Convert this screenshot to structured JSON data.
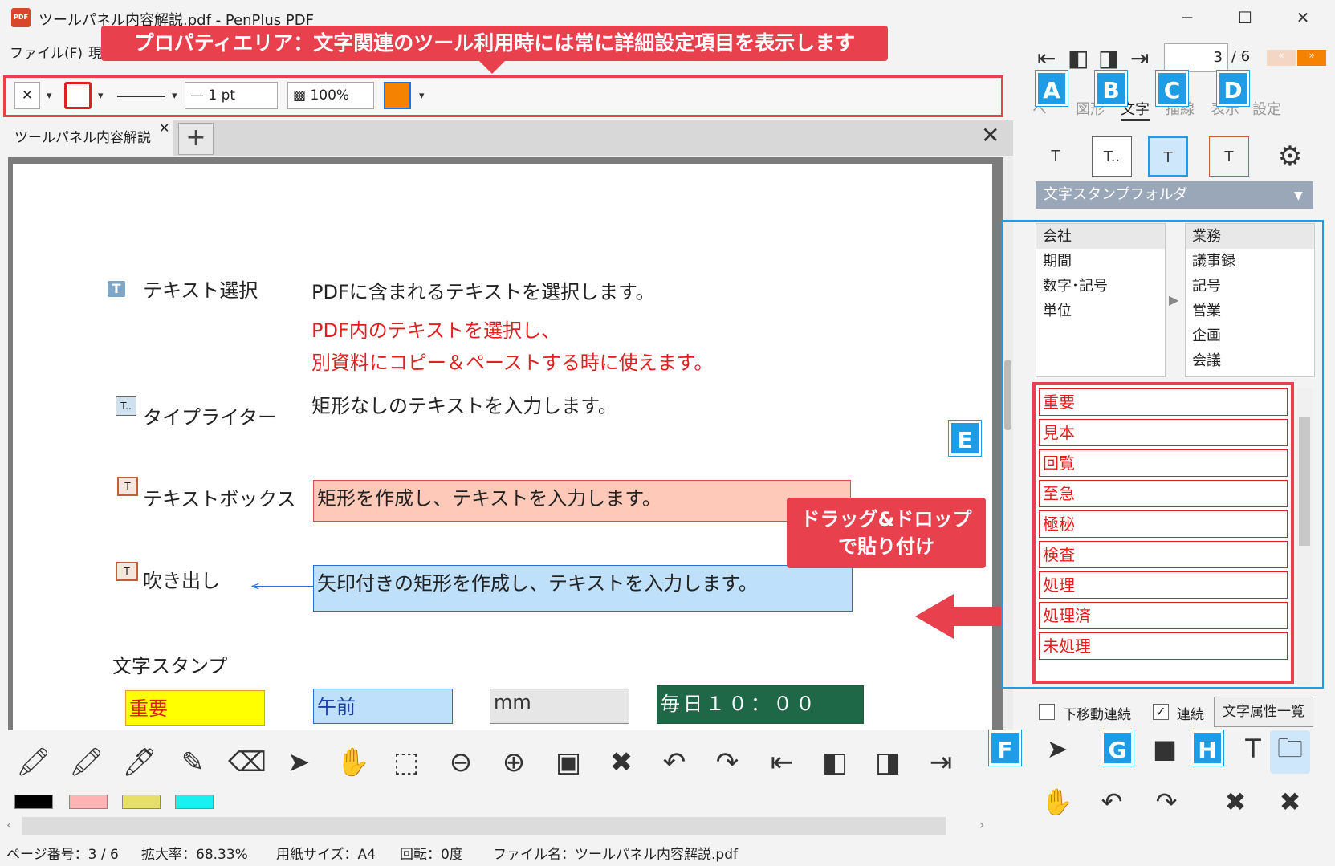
{
  "window": {
    "title": "ツールパネル内容解説.pdf - PenPlus PDF",
    "app_icon": "PDF",
    "minimize": "─",
    "maximize": "☐",
    "close": "✕"
  },
  "menu": {
    "file": "ファイル(F)",
    "edit_partial": "現"
  },
  "callouts": {
    "property": "プロパティエリア：文字関連のツール利用時には常に詳細設定項目を表示します",
    "drag_line1": "ドラッグ&ドロップ",
    "drag_line2": "で貼り付け"
  },
  "propbar": {
    "clear": "✕",
    "line_width": "— 1 pt",
    "opacity": "100%",
    "colors": {
      "border": "#e02020",
      "fill": "#f58200"
    }
  },
  "tabs": {
    "doc": "ツールパネル内容解説",
    "close": "✕",
    "add": "+",
    "close_doc": "✕"
  },
  "page": {
    "items": [
      {
        "icon": "T",
        "label": "テキスト選択",
        "desc": "PDFに含まれるテキストを選択します。",
        "note1": "PDF内のテキストを選択し、",
        "note2": "別資料にコピー＆ペーストする時に使えます。"
      },
      {
        "icon": "T..",
        "label": "タイプライター",
        "desc": "矩形なしのテキストを入力します。"
      },
      {
        "icon": "T",
        "label": "テキストボックス",
        "desc": "矩形を作成し、テキストを入力します。"
      },
      {
        "icon": "T",
        "label": "吹き出し",
        "desc": "矢印付きの矩形を作成し、テキストを入力します。"
      }
    ],
    "stamp_heading": "文字スタンプ",
    "stamps": [
      "重要",
      "午前",
      "mm",
      "毎日１０：００"
    ]
  },
  "swatches": [
    "#000000",
    "#ffb3b3",
    "#e8e066",
    "#19f0f0"
  ],
  "status": {
    "page": "ページ番号：3 / 6",
    "zoom": "拡大率：68.33%",
    "paper": "用紙サイズ：A4",
    "rotate": "回転：0度",
    "file": "ファイル名：ツールパネル内容解説.pdf"
  },
  "nav": {
    "current_page": "3",
    "total": "/ 6"
  },
  "panel_tabs": [
    "ペ",
    "図形",
    "文字",
    "描線",
    "表示",
    "設定"
  ],
  "badges": {
    "a": "A",
    "b": "B",
    "c": "C",
    "d": "D",
    "e": "E",
    "f": "F",
    "g": "G",
    "h": "H"
  },
  "tools": {
    "text_select": "T",
    "typewriter": "T..",
    "textbox": "T",
    "callout": "T"
  },
  "folder": "文字スタンプフォルダ",
  "folder_left": [
    "会社",
    "期間",
    "数字･記号",
    "単位"
  ],
  "folder_right": [
    "業務",
    "議事録",
    "記号",
    "営業",
    "企画",
    "会議"
  ],
  "stamp_list": [
    "重要",
    "見本",
    "回覧",
    "至急",
    "極秘",
    "検査",
    "処理",
    "処理済",
    "未処理"
  ],
  "options": {
    "move_down": "下移動連続",
    "continuous": "連続",
    "attr_list": "文字属性一覧"
  }
}
